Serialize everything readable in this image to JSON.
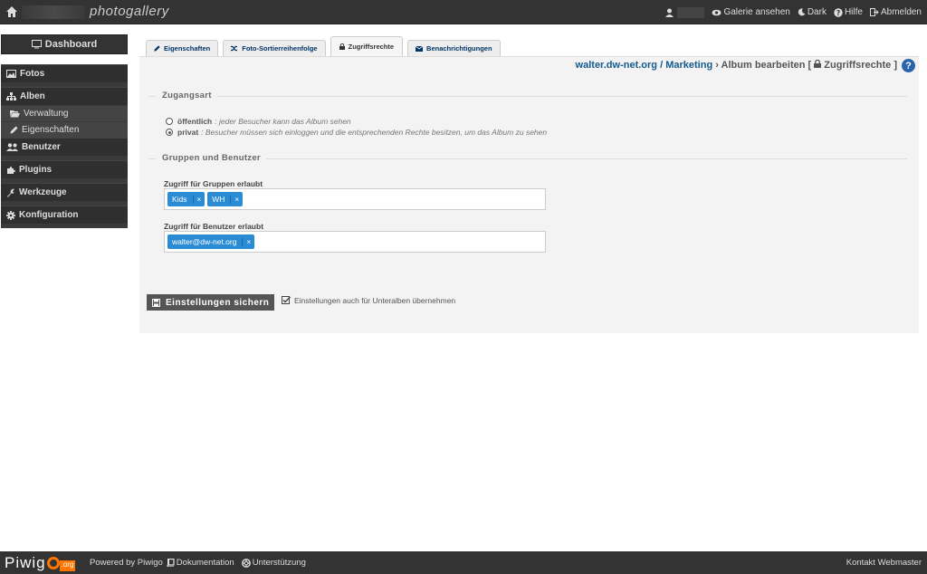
{
  "topbar": {
    "title": "photogallery",
    "items": [
      "Galerie ansehen",
      "Dark",
      "Hilfe",
      "Abmelden"
    ]
  },
  "sidebar": {
    "dashboard": "Dashboard",
    "sections": {
      "fotos": "Fotos",
      "alben": "Alben",
      "verwaltung": "Verwaltung",
      "eigenschaften": "Eigenschaften",
      "benutzer": "Benutzer",
      "plugins": "Plugins",
      "werkzeuge": "Werkzeuge",
      "konfiguration": "Konfiguration"
    }
  },
  "tabs": [
    "Eigenschaften",
    "Foto-Sortierreihenfolge",
    "Zugriffsrechte",
    "Benachrichtigungen"
  ],
  "breadcrumb": {
    "site": "walter.dw-net.org",
    "sep1": "/",
    "album": "Marketing",
    "rest": "› Album bearbeiten [",
    "section": "Zugriffsrechte",
    "close": "]"
  },
  "zugangsart": {
    "legend": "Zugangsart",
    "public_label": "öffentlich",
    "public_desc": ": jeder Besucher kann das Album sehen",
    "private_label": "privat",
    "private_desc": ": Besucher müssen sich einloggen und die entsprechenden Rechte besitzen, um das Album zu sehen"
  },
  "gruppen": {
    "legend": "Gruppen und Benutzer",
    "groups_label": "Zugriff für Gruppen erlaubt",
    "groups": [
      "Kids",
      "WH"
    ],
    "users_label": "Zugriff für Benutzer erlaubt",
    "users": [
      "walter@dw-net.org"
    ],
    "remove": "×"
  },
  "actions": {
    "save": "Einstellungen sichern",
    "apply_sub": "Einstellungen auch für Unteralben übernehmen"
  },
  "footer": {
    "logo_text": "Piwig",
    "logo_org": ".org",
    "powered": "Powered by Piwigo",
    "docs": "Dokumentation",
    "support": "Unterstützung",
    "contact": "Kontakt Webmaster"
  }
}
